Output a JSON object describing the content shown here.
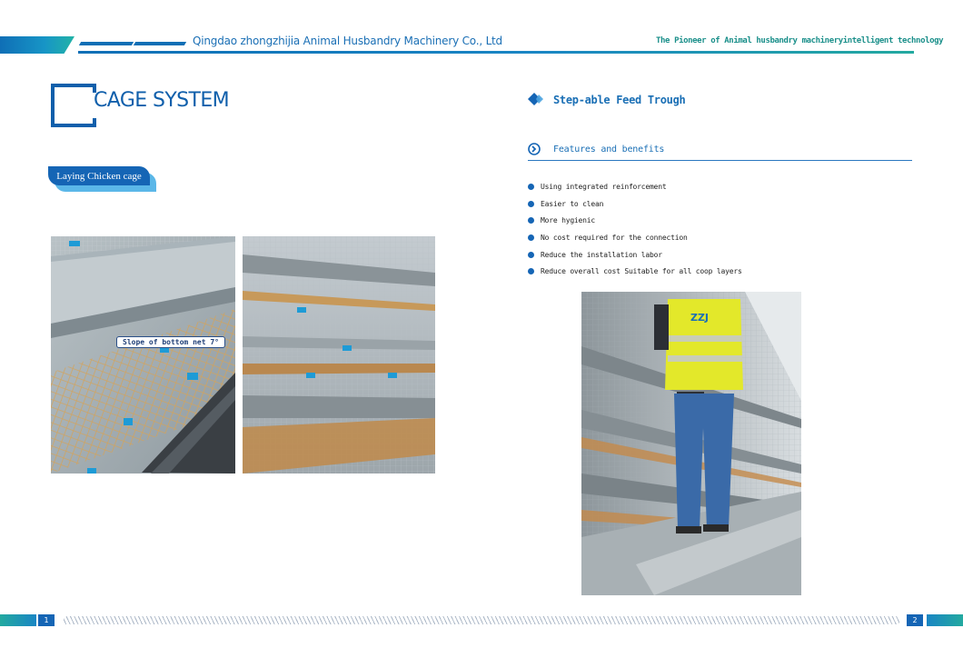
{
  "header": {
    "company": "Qingdao zhongzhijia Animal Husbandry Machinery Co., Ltd",
    "slogan": "The Pioneer of Animal husbandry machineryintelligent technology"
  },
  "left": {
    "title": "CAGE SYSTEM",
    "tag": "Laying Chicken cage",
    "callout": "Slope of bottom net 7°"
  },
  "right": {
    "section_title": "Step-able Feed Trough",
    "features_title": "Features and benefits",
    "features": [
      "Using integrated reinforcement",
      "Easier to clean",
      "More hygienic",
      "No cost required for the connection",
      "Reduce the installation labor",
      "Reduce overall cost  Suitable for all coop layers"
    ]
  },
  "footer": {
    "page_left": "1",
    "page_right": "2"
  },
  "colors": {
    "primary": "#1565b5",
    "teal": "#23a9a0",
    "text_blue": "#1a6fb5"
  },
  "icons": {
    "section": "diamond-icon",
    "features": "chevron-circle-icon",
    "bullet": "dot-icon"
  }
}
